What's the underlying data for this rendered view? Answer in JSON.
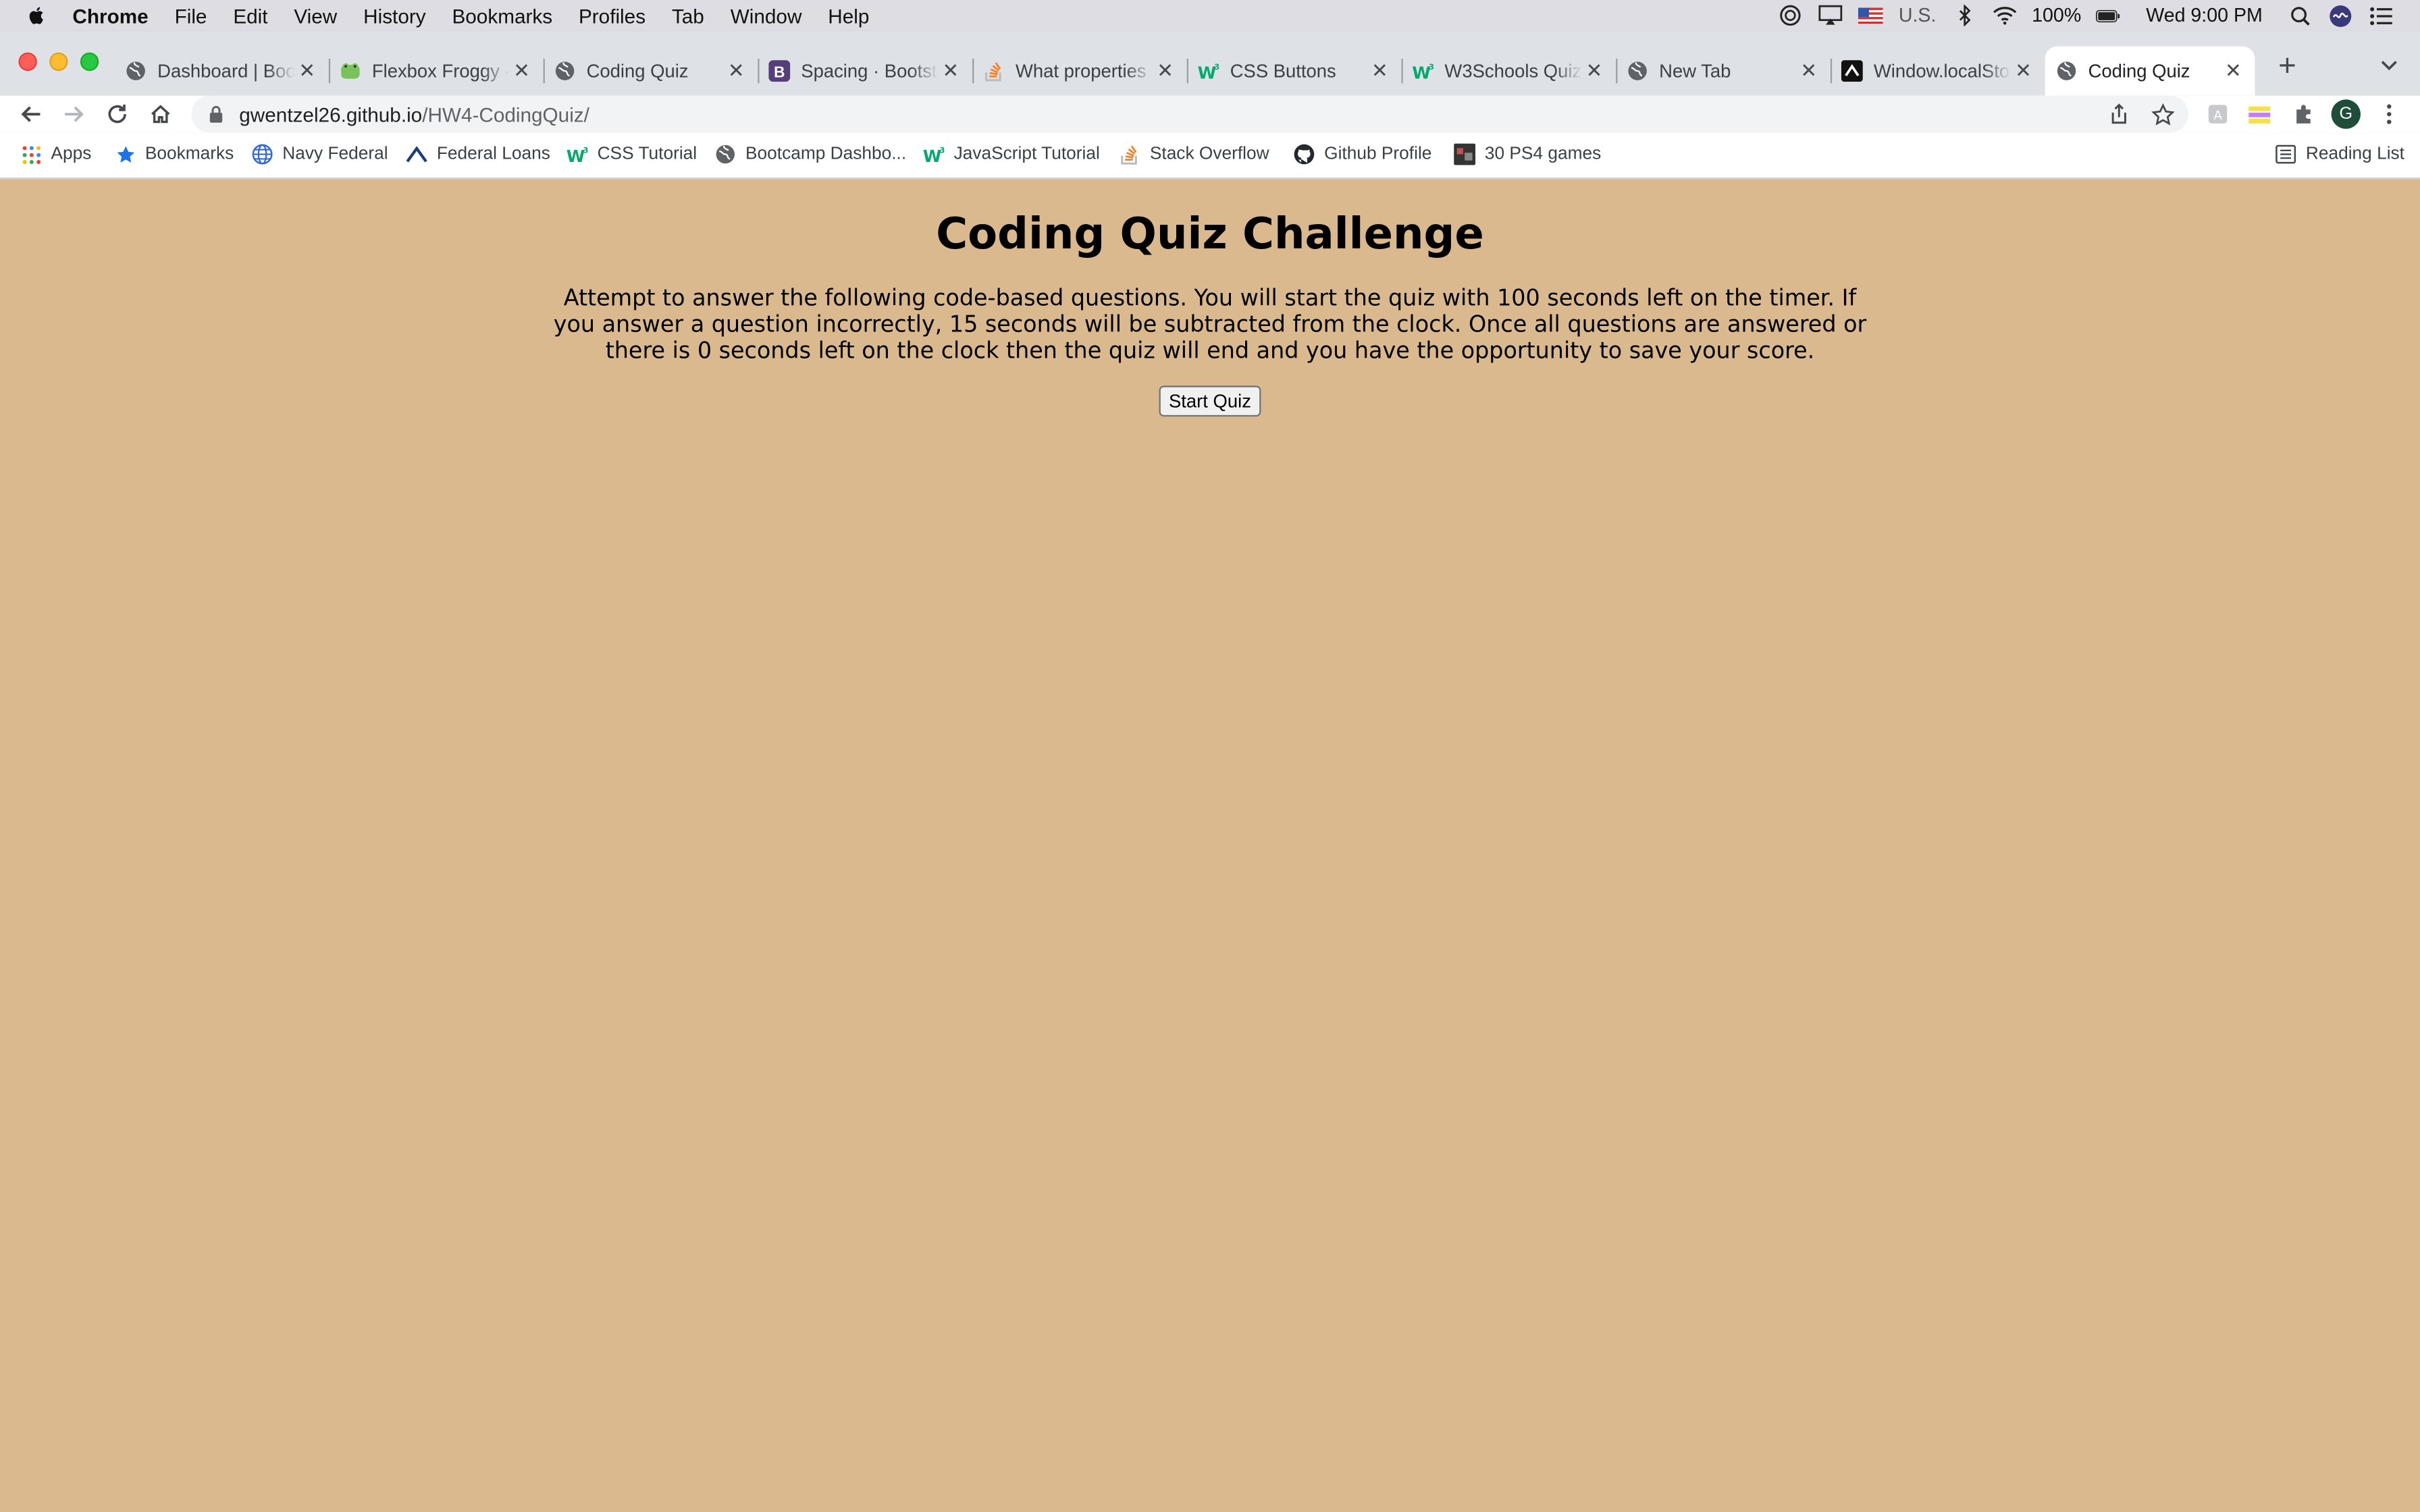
{
  "menubar": {
    "app_name": "Chrome",
    "items": [
      "File",
      "Edit",
      "View",
      "History",
      "Bookmarks",
      "Profiles",
      "Tab",
      "Window",
      "Help"
    ],
    "input_source": "U.S.",
    "battery": "100%",
    "clock": "Wed 9:00 PM"
  },
  "tabs": [
    {
      "title": "Dashboard | Boo",
      "icon": "globe-icon"
    },
    {
      "title": "Flexbox Froggy -",
      "icon": "frog-icon"
    },
    {
      "title": "Coding Quiz",
      "icon": "globe-icon"
    },
    {
      "title": "Spacing · Bootst",
      "icon": "bootstrap-icon"
    },
    {
      "title": "What properties",
      "icon": "stackoverflow-icon"
    },
    {
      "title": "CSS Buttons",
      "icon": "w3schools-icon"
    },
    {
      "title": "W3Schools Quiz",
      "icon": "w3schools-icon"
    },
    {
      "title": "New Tab",
      "icon": "globe-icon"
    },
    {
      "title": "Window.localSto",
      "icon": "mdn-icon"
    },
    {
      "title": "Coding Quiz",
      "icon": "globe-icon",
      "active": true
    }
  ],
  "address": {
    "host": "gwentzel26.github.io",
    "path": "/HW4-CodingQuiz/"
  },
  "profile_initial": "G",
  "bookmarks": [
    {
      "label": "Apps",
      "icon": "apps-grid-icon"
    },
    {
      "label": "Bookmarks",
      "icon": "star-icon"
    },
    {
      "label": "Navy Federal",
      "icon": "globe-icon"
    },
    {
      "label": "Federal Loans",
      "icon": "federal-loans-icon"
    },
    {
      "label": "CSS Tutorial",
      "icon": "w3schools-icon"
    },
    {
      "label": "Bootcamp Dashbo...",
      "icon": "globe-icon"
    },
    {
      "label": "JavaScript Tutorial",
      "icon": "w3schools-icon"
    },
    {
      "label": "Stack Overflow",
      "icon": "stackoverflow-icon"
    },
    {
      "label": "Github Profile",
      "icon": "github-icon"
    },
    {
      "label": "30 PS4 games",
      "icon": "game-thumb-icon"
    }
  ],
  "reading_list": "Reading List",
  "page": {
    "title": "Coding Quiz Challenge",
    "instructions": "Attempt to answer the following code-based questions. You will start the quiz with 100 seconds left on the timer. If you answer a question incorrectly, 15 seconds will be subtracted from the clock. Once all questions are answered or there is 0 seconds left on the clock then the quiz will end and you have the opportunity to save your score.",
    "start_button": "Start Quiz"
  },
  "colors": {
    "page_background": "#d9b98d",
    "tabstrip": "#dee1e6",
    "close_red": "#ff5f57",
    "minimize_yellow": "#febc2e",
    "zoom_green": "#28c840"
  }
}
